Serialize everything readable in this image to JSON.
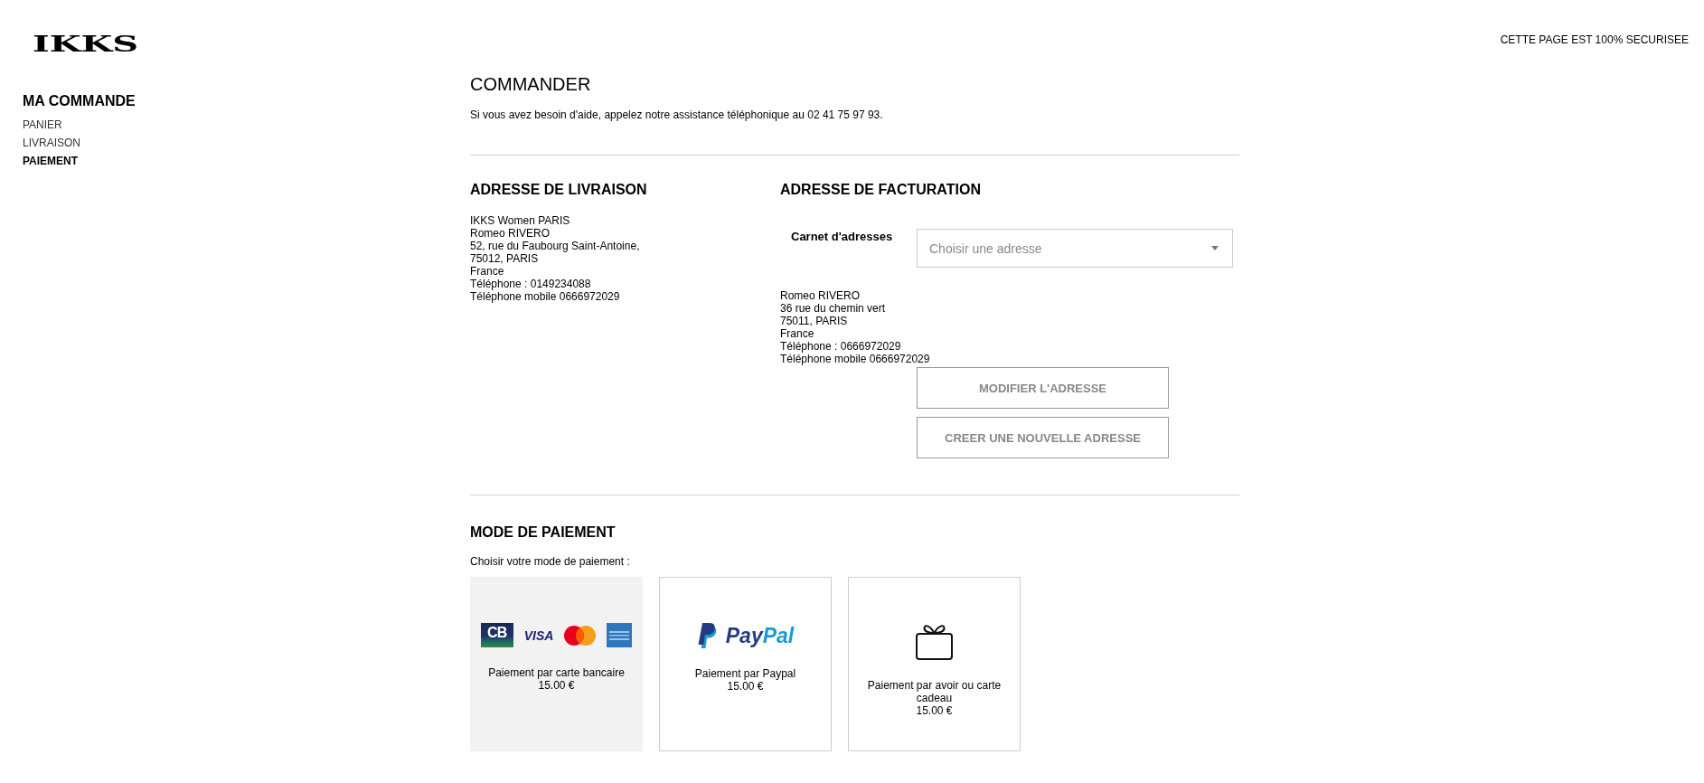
{
  "header": {
    "logo": "IKKS",
    "security_note": "CETTE PAGE EST 100% SECURISEE"
  },
  "sidebar": {
    "title": "MA COMMANDE",
    "items": [
      {
        "label": "PANIER",
        "selected": false
      },
      {
        "label": "LIVRAISON",
        "selected": false
      },
      {
        "label": "PAIEMENT",
        "selected": true
      }
    ]
  },
  "checkout": {
    "title": "COMMANDER",
    "help_text": "Si vous avez besoin d'aide, appelez notre assistance téléphonique au 02 41 75 97 93."
  },
  "delivery_address": {
    "heading": "ADRESSE DE LIVRAISON",
    "lines": [
      "IKKS Women PARIS",
      "Romeo RIVERO",
      "52, rue du Faubourg Saint-Antoine,",
      "75012, PARIS",
      "France",
      "Téléphone : 0149234088",
      "Téléphone mobile 0666972029"
    ]
  },
  "billing_address": {
    "heading": "ADRESSE DE FACTURATION",
    "address_book": {
      "label": "Carnet d'adresses",
      "placeholder": "Choisir une adresse"
    },
    "lines": [
      "Romeo RIVERO",
      "36 rue du chemin vert",
      "75011, PARIS",
      "France",
      "Téléphone : 0666972029",
      "Téléphone mobile 0666972029"
    ],
    "buttons": [
      "MODIFIER L'ADRESSE",
      "CREER UNE NOUVELLE ADRESSE"
    ]
  },
  "payment": {
    "heading": "MODE DE PAIEMENT",
    "prompt": "Choisir votre mode de paiement :",
    "options": [
      {
        "selected": true,
        "logos": [
          {
            "kind": "cb",
            "text": "CB"
          },
          {
            "kind": "visa",
            "text": "VISA"
          },
          {
            "kind": "mastercard"
          },
          {
            "kind": "amex"
          }
        ],
        "label": "Paiement par carte bancaire",
        "price": "15.00 €"
      },
      {
        "selected": false,
        "logos": [
          {
            "kind": "paypal-mark"
          },
          {
            "kind": "wordmark",
            "parts": [
              "Pay",
              "Pal"
            ]
          }
        ],
        "label": "Paiement par Paypal",
        "price": "15.00 €"
      },
      {
        "selected": false,
        "logos": [
          {
            "kind": "gift"
          }
        ],
        "label": "Paiement par avoir ou carte cadeau",
        "price": "15.00 €"
      }
    ]
  }
}
